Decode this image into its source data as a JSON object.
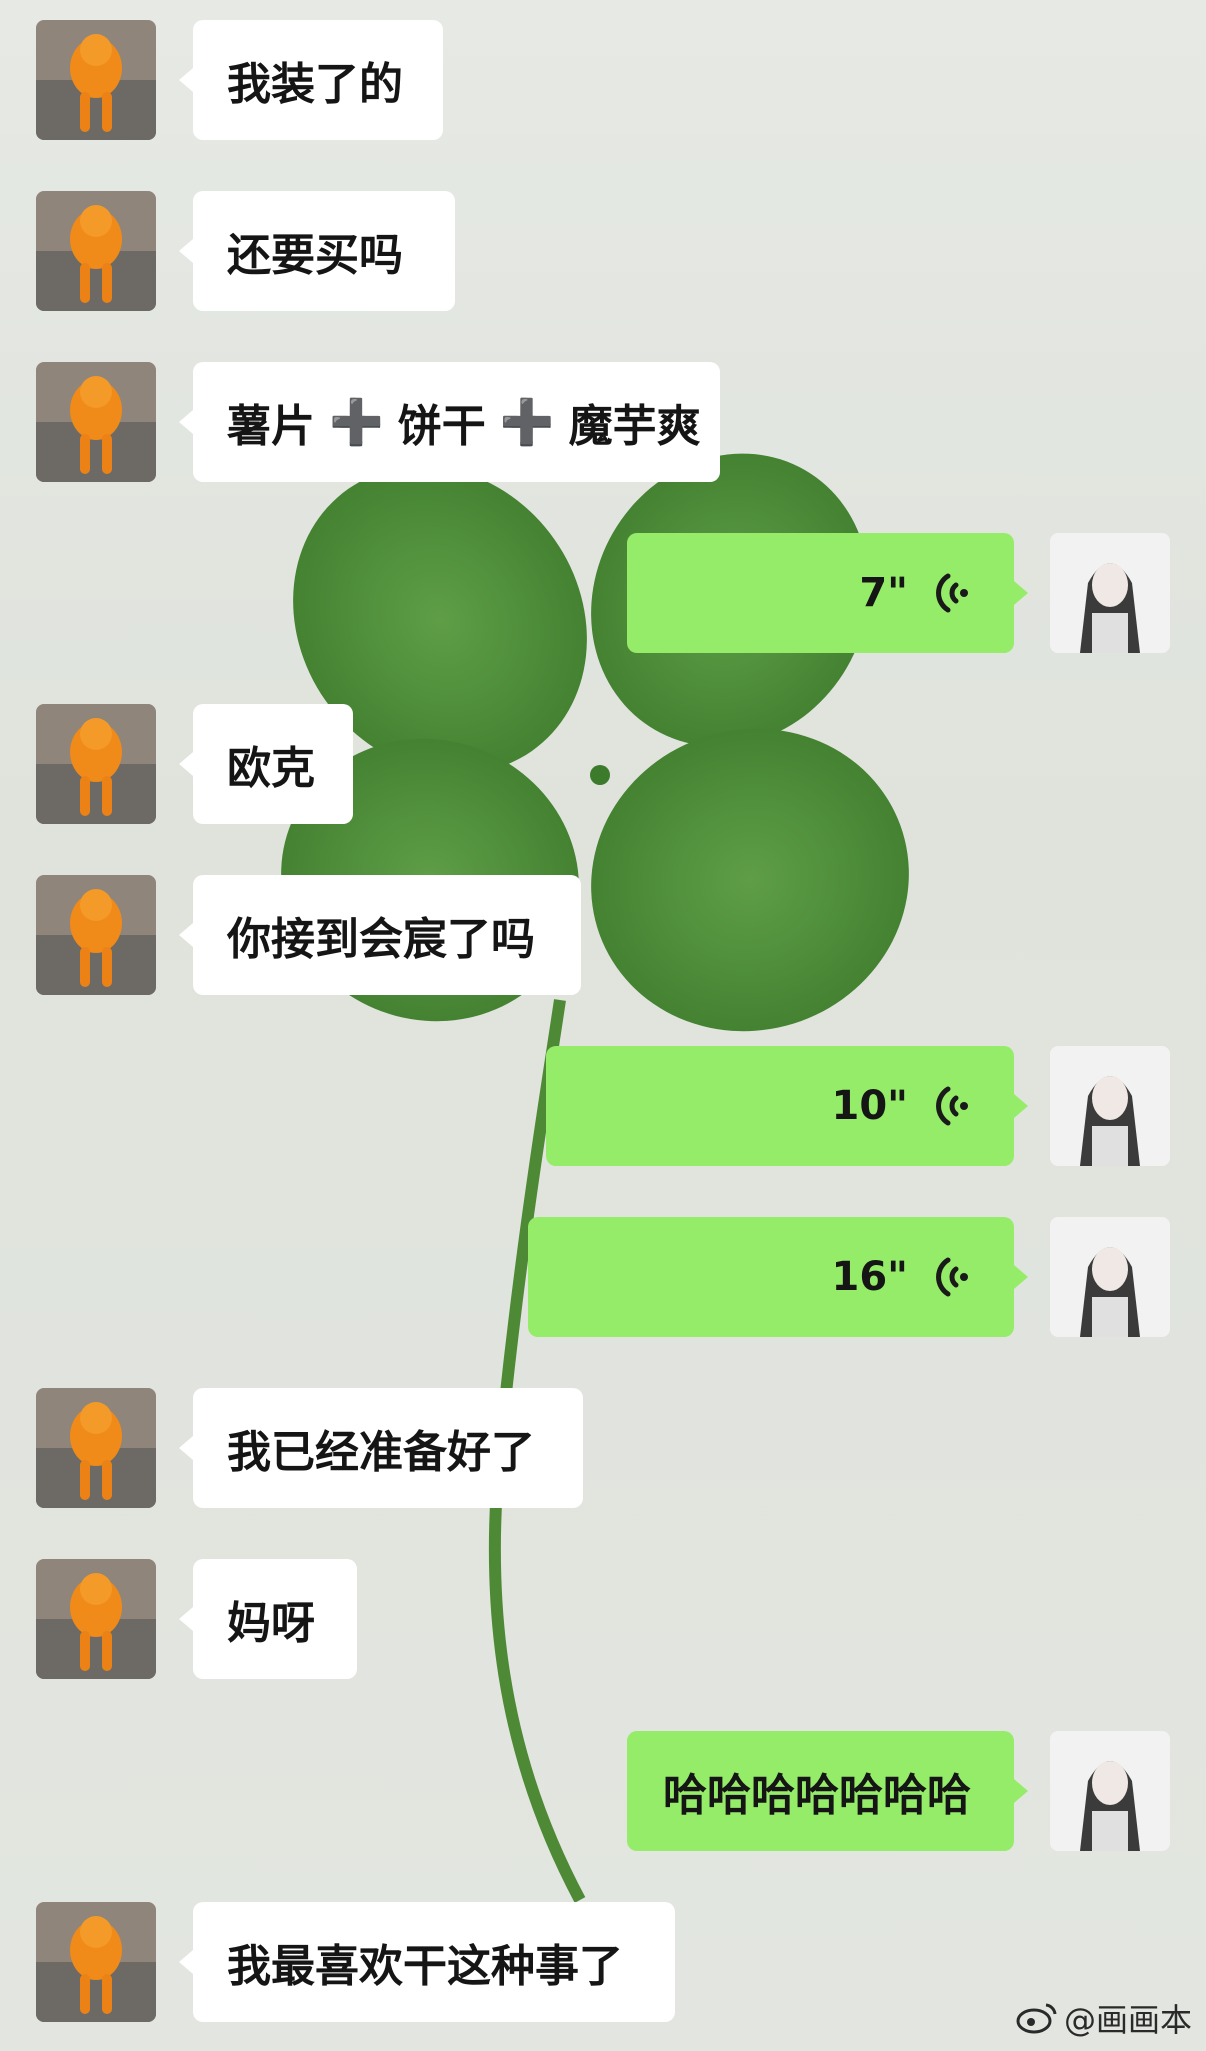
{
  "messages": [
    {
      "side": "in",
      "text": "我装了的"
    },
    {
      "side": "in",
      "text": "还要买吗"
    },
    {
      "side": "in",
      "parts": [
        "薯片",
        "饼干",
        "魔芋爽"
      ],
      "plus": "➕"
    },
    {
      "side": "out",
      "kind": "voice",
      "duration": "7\""
    },
    {
      "side": "in",
      "text": "欧克"
    },
    {
      "side": "in",
      "text": "你接到会宸了吗"
    },
    {
      "side": "out",
      "kind": "voice",
      "duration": "10\""
    },
    {
      "side": "out",
      "kind": "voice",
      "duration": "16\""
    },
    {
      "side": "in",
      "text": "我已经准备好了"
    },
    {
      "side": "in",
      "text": "妈呀"
    },
    {
      "side": "out",
      "text": "哈哈哈哈哈哈哈"
    },
    {
      "side": "in",
      "text": "我最喜欢干这种事了"
    }
  ],
  "watermark": {
    "text": "@画画本",
    "icon": "weibo-icon"
  },
  "colors": {
    "incoming": "#ffffff",
    "outgoing": "#95ec69",
    "leaf": "#4f8f3a"
  }
}
